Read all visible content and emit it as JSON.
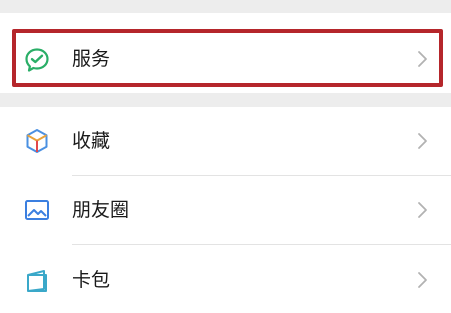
{
  "menu": {
    "items": [
      {
        "label": "服务",
        "icon": "wechat-pay-icon",
        "color": "#2aae67",
        "highlighted": true
      },
      {
        "label": "收藏",
        "icon": "favorites-cube-icon",
        "color": "#e9a23b"
      },
      {
        "label": "朋友圈",
        "icon": "moments-photo-icon",
        "color": "#3b7fe0"
      },
      {
        "label": "卡包",
        "icon": "card-pack-icon",
        "color": "#3aa8c9"
      }
    ]
  },
  "colors": {
    "highlight_border": "#b5262b",
    "section_gap": "#ededed",
    "chevron": "#b2b2b2"
  }
}
